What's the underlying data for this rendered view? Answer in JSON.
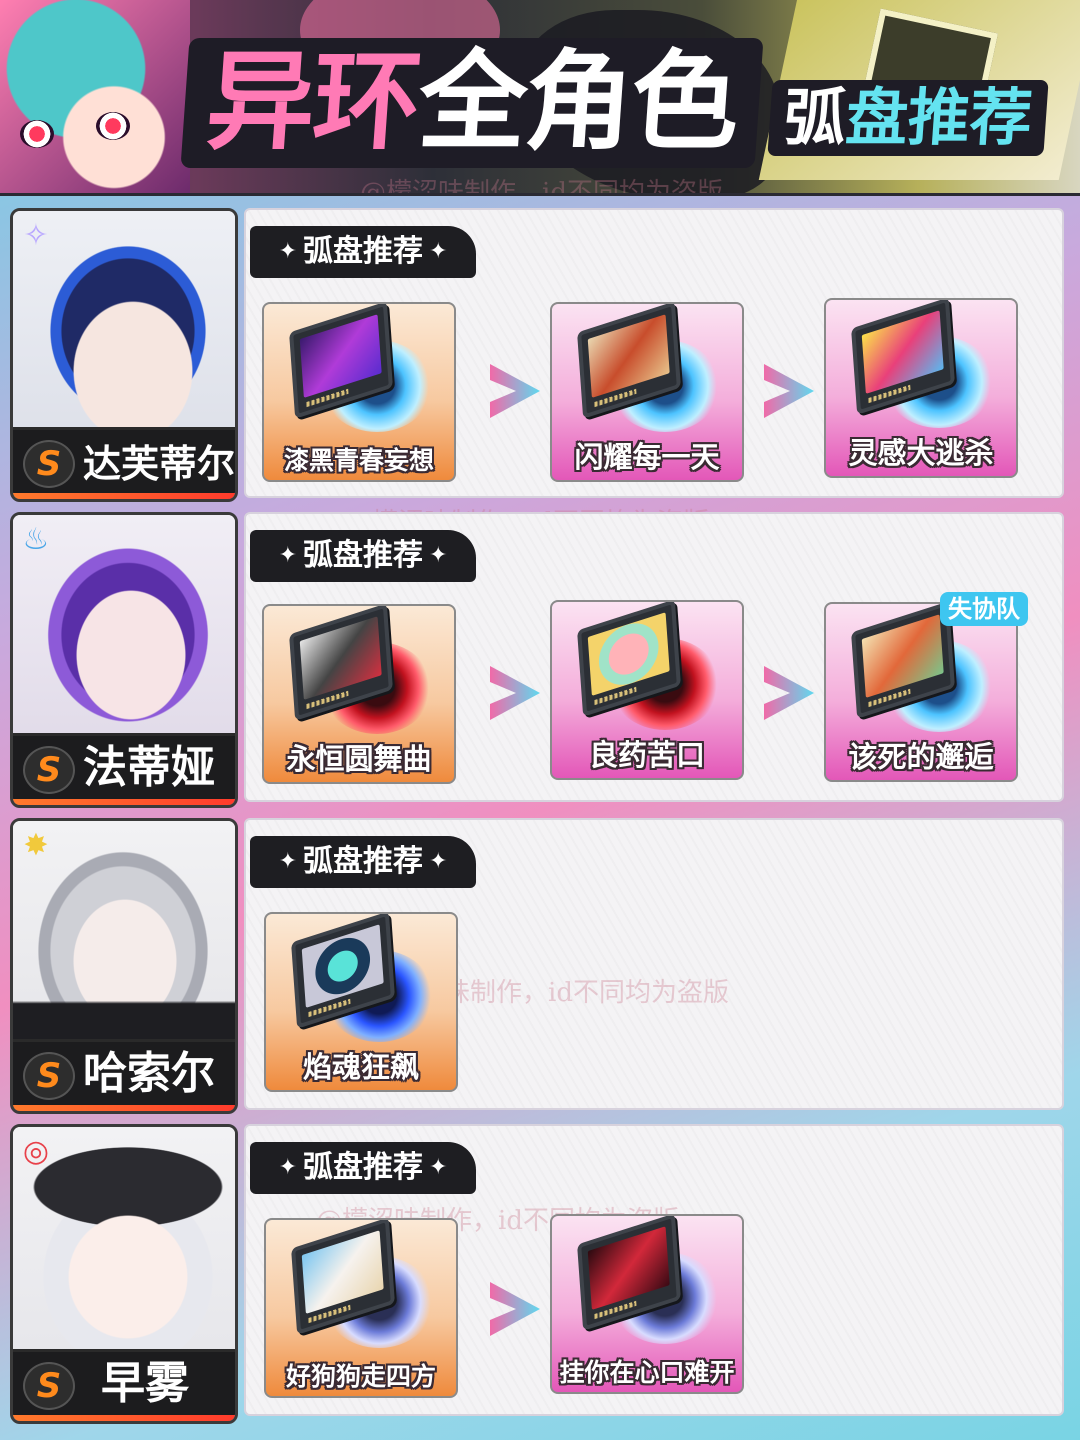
{
  "banner": {
    "title_part1": "异环",
    "title_part2": "全角色",
    "subtitle_part1": "弧",
    "subtitle_part2": "盘推荐"
  },
  "watermark": "@檬涩味制作，id不同均为盗版",
  "section_label": "弧盘推荐",
  "rank_label": "S",
  "characters": [
    {
      "name": "达芙蒂尔",
      "element_icon": "sparkle-element-icon",
      "element_color": "#b9a8ff",
      "discs": [
        {
          "name": "漆黑青春妄想",
          "card_color": "orange"
        },
        {
          "name": "闪耀每一天",
          "card_color": "pink"
        },
        {
          "name": "灵感大逃杀",
          "card_color": "pink"
        }
      ]
    },
    {
      "name": "法蒂娅",
      "element_icon": "flame-element-icon",
      "element_color": "#4aa6e8",
      "discs": [
        {
          "name": "永恒圆舞曲",
          "card_color": "orange"
        },
        {
          "name": "良药苦口",
          "card_color": "pink"
        },
        {
          "name": "该死的邂逅",
          "card_color": "pink",
          "badge": "失协队"
        }
      ]
    },
    {
      "name": "哈索尔",
      "element_icon": "star-element-icon",
      "element_color": "#f1c93c",
      "discs": [
        {
          "name": "焰魂狂飙",
          "card_color": "orange"
        }
      ]
    },
    {
      "name": "早雾",
      "element_icon": "target-element-icon",
      "element_color": "#e8414a",
      "discs": [
        {
          "name": "好狗狗走四方",
          "card_color": "orange"
        },
        {
          "name": "挂你在心口难开",
          "card_color": "pink"
        }
      ]
    }
  ],
  "colors": {
    "accent_pink": "#ff7ab5",
    "accent_cyan": "#64e3f0",
    "rank_orange": "#ff8a1c"
  }
}
